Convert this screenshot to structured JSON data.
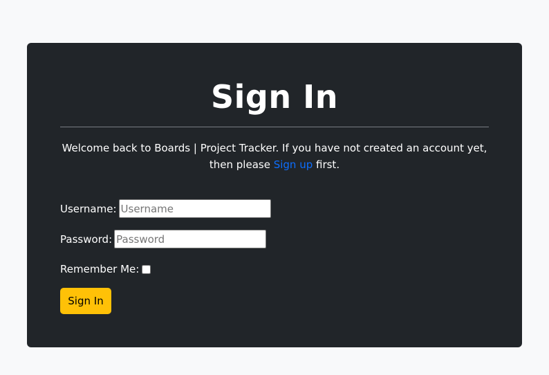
{
  "page": {
    "title": "Sign In",
    "welcome_text": "Welcome back to Boards | Project Tracker. If you have not created an account yet, then please",
    "signup_link": "Sign up",
    "welcome_suffix": " first."
  },
  "form": {
    "username_label": "Username:",
    "username_placeholder": "Username",
    "username_value": "",
    "password_label": "Password:",
    "password_placeholder": "Password",
    "password_value": "",
    "remember_label": "Remember Me:",
    "remember_checked": false,
    "submit_label": "Sign In"
  },
  "colors": {
    "page_background": "#f8f9fa",
    "card_background": "#212529",
    "link": "#0d6efd",
    "button": "#ffc107"
  }
}
